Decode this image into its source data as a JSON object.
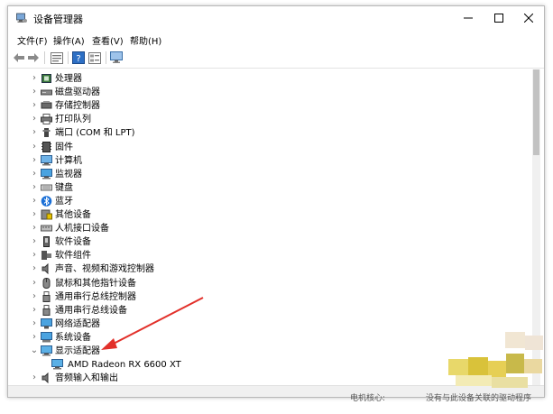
{
  "window": {
    "title": "设备管理器",
    "icon": "device-manager-icon"
  },
  "menu": [
    {
      "label": "文件(F)"
    },
    {
      "label": "操作(A)"
    },
    {
      "label": "查看(V)"
    },
    {
      "label": "帮助(H)"
    }
  ],
  "toolbar": {
    "icons": [
      "back-arrow-icon",
      "forward-arrow-icon",
      "properties-icon",
      "help-icon",
      "view-icon",
      "monitor-icon"
    ]
  },
  "tree": [
    {
      "label": "处理器",
      "icon": "processor-icon",
      "expanded": false
    },
    {
      "label": "磁盘驱动器",
      "icon": "disk-drive-icon",
      "expanded": false
    },
    {
      "label": "存储控制器",
      "icon": "storage-controller-icon",
      "expanded": false
    },
    {
      "label": "打印队列",
      "icon": "printer-icon",
      "expanded": false
    },
    {
      "label": "端口 (COM 和 LPT)",
      "icon": "port-icon",
      "expanded": false
    },
    {
      "label": "固件",
      "icon": "firmware-icon",
      "expanded": false
    },
    {
      "label": "计算机",
      "icon": "computer-icon",
      "expanded": false
    },
    {
      "label": "监视器",
      "icon": "monitor-icon",
      "expanded": false
    },
    {
      "label": "键盘",
      "icon": "keyboard-icon",
      "expanded": false
    },
    {
      "label": "蓝牙",
      "icon": "bluetooth-icon",
      "expanded": false
    },
    {
      "label": "其他设备",
      "icon": "other-device-icon",
      "expanded": false
    },
    {
      "label": "人机接口设备",
      "icon": "hid-icon",
      "expanded": false
    },
    {
      "label": "软件设备",
      "icon": "software-device-icon",
      "expanded": false
    },
    {
      "label": "软件组件",
      "icon": "software-component-icon",
      "expanded": false
    },
    {
      "label": "声音、视频和游戏控制器",
      "icon": "sound-icon",
      "expanded": false
    },
    {
      "label": "鼠标和其他指针设备",
      "icon": "mouse-icon",
      "expanded": false
    },
    {
      "label": "通用串行总线控制器",
      "icon": "usb-icon",
      "expanded": false
    },
    {
      "label": "通用串行总线设备",
      "icon": "usb-device-icon",
      "expanded": false
    },
    {
      "label": "网络适配器",
      "icon": "network-adapter-icon",
      "expanded": false
    },
    {
      "label": "系统设备",
      "icon": "system-device-icon",
      "expanded": false
    },
    {
      "label": "显示适配器",
      "icon": "display-adapter-icon",
      "expanded": true
    },
    {
      "label": "AMD Radeon RX 6600 XT",
      "icon": "display-adapter-icon",
      "child": true
    },
    {
      "label": "音频输入和输出",
      "icon": "audio-icon",
      "expanded": false
    }
  ],
  "bottom_fragments": [
    "电机核心:",
    "没有与此设备关联的驱动程序"
  ]
}
